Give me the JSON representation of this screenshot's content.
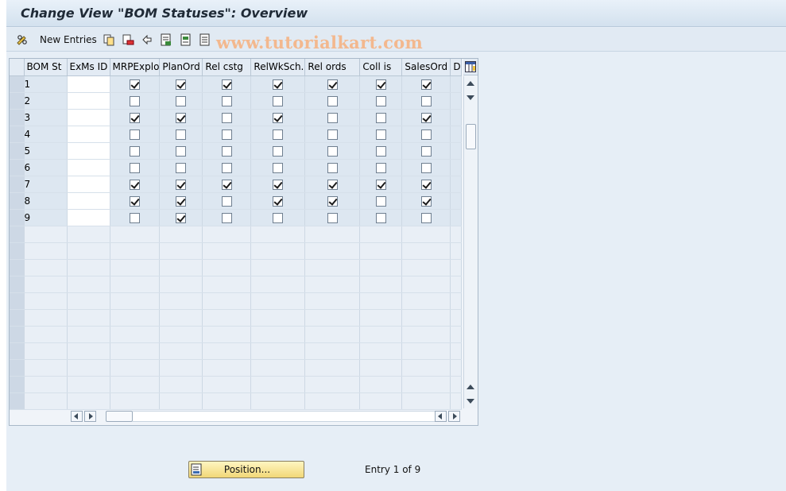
{
  "window": {
    "title": "Change View \"BOM Statuses\": Overview"
  },
  "toolbar": {
    "new_entries_label": "New Entries",
    "watermark": "www.tutorialkart.com"
  },
  "table": {
    "columns": [
      "BOM St",
      "ExMs ID",
      "MRPExplo",
      "PlanOrd",
      "Rel cstg",
      "RelWkSch.",
      "Rel ords",
      "Coll is",
      "SalesOrd",
      "D"
    ],
    "rows": [
      {
        "bom_st": "1",
        "exms_id": "",
        "checks": [
          true,
          true,
          true,
          true,
          true,
          true,
          true
        ]
      },
      {
        "bom_st": "2",
        "exms_id": "",
        "checks": [
          false,
          false,
          false,
          false,
          false,
          false,
          false
        ]
      },
      {
        "bom_st": "3",
        "exms_id": "",
        "checks": [
          true,
          true,
          false,
          true,
          false,
          false,
          true
        ]
      },
      {
        "bom_st": "4",
        "exms_id": "",
        "checks": [
          false,
          false,
          false,
          false,
          false,
          false,
          false
        ]
      },
      {
        "bom_st": "5",
        "exms_id": "",
        "checks": [
          false,
          false,
          false,
          false,
          false,
          false,
          false
        ]
      },
      {
        "bom_st": "6",
        "exms_id": "",
        "checks": [
          false,
          false,
          false,
          false,
          false,
          false,
          false
        ]
      },
      {
        "bom_st": "7",
        "exms_id": "",
        "checks": [
          true,
          true,
          true,
          true,
          true,
          true,
          true
        ]
      },
      {
        "bom_st": "8",
        "exms_id": "",
        "checks": [
          true,
          true,
          false,
          true,
          true,
          false,
          true
        ]
      },
      {
        "bom_st": "9",
        "exms_id": "",
        "checks": [
          false,
          true,
          false,
          false,
          false,
          false,
          false
        ]
      }
    ],
    "empty_rows": 11
  },
  "footer": {
    "position_label": "Position...",
    "entry_info": "Entry 1 of 9"
  },
  "colors": {
    "title_text": "#1f2a36",
    "watermark": "#f3b88e",
    "button_bg": "#f1d777"
  }
}
